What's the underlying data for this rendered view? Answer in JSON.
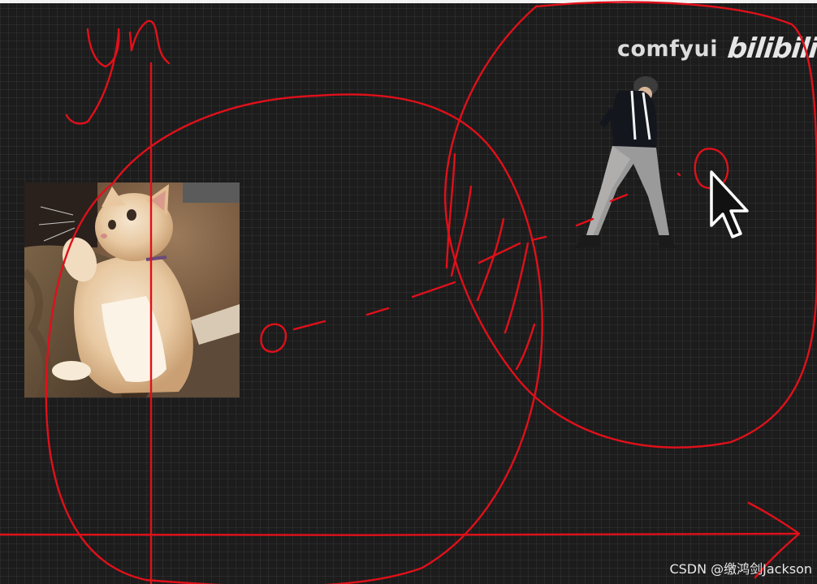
{
  "canvas": {
    "background": "#1c1c1c",
    "ink_color": "#e0101a"
  },
  "logo": {
    "primary": "comfyui",
    "secondary": "bilibili"
  },
  "annotation_text": {
    "axis_label": "yn"
  },
  "watermark": {
    "text": "CSDN @缴鸿剑Jackson"
  },
  "icons": {
    "cursor": "mouse-pointer-icon"
  }
}
